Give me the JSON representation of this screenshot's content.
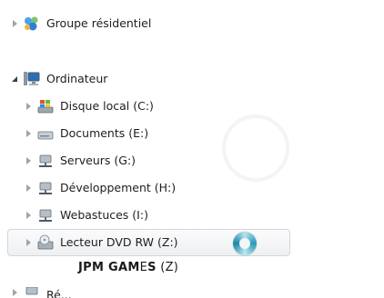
{
  "nav": {
    "homegroup_label": "Groupe résidentiel",
    "computer_label": "Ordinateur",
    "drives": [
      "Disque local (C:)",
      "Documents (E:)",
      "Serveurs (G:)",
      "Développement (H:)",
      "Webastuces (I:)",
      "Lecteur DVD RW (Z:)"
    ],
    "network_label_partial": "Ré..."
  },
  "tooltip": {
    "p1": "J",
    "p2": "PM GAM",
    "p3": "E",
    "p4": "S",
    "suffix": " (Z)"
  },
  "colors": {
    "hover_border": "#d2d6db",
    "triangle": "#9aa5b1",
    "spinner_accent": "#2a9ab8"
  }
}
